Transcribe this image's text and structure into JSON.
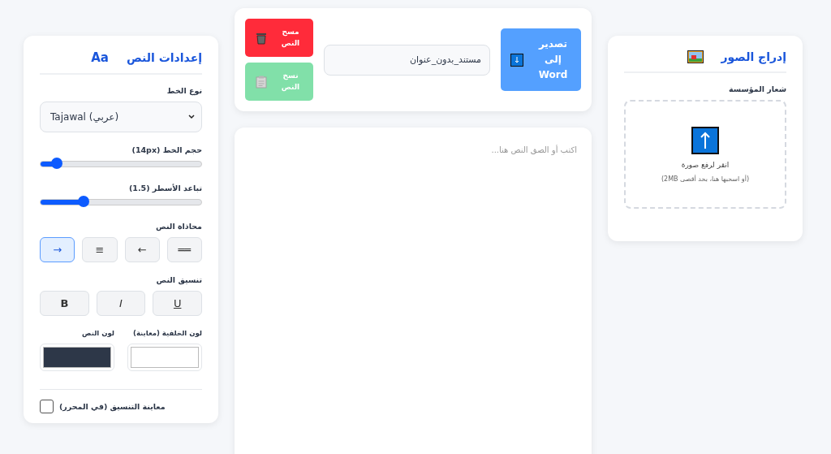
{
  "settings_panel": {
    "title": "إعدادات النص",
    "title_icon": "Aa",
    "font_family": {
      "label": "نوع الخط",
      "value": "Tajawal (عربي)"
    },
    "font_size": {
      "label": "حجم الخط (14px)",
      "level": 0.1
    },
    "line_height": {
      "label": "تباعد الأسطر (1.5)",
      "level": 0.27
    },
    "alignment": {
      "label": "محاذاة النص",
      "options": [
        {
          "symbol": "══",
          "selected": false
        },
        {
          "symbol": "←",
          "selected": false
        },
        {
          "symbol": "≡",
          "selected": false
        },
        {
          "symbol": "→",
          "selected": true
        }
      ]
    },
    "formatting": {
      "label": "تنسيق النص",
      "options": [
        {
          "symbol": "U",
          "kind": "underline"
        },
        {
          "symbol": "I",
          "kind": "italic"
        },
        {
          "symbol": "B",
          "kind": "bold"
        }
      ]
    },
    "colors": [
      {
        "label": "لون الخلفية (معاينة)",
        "color": "#ffffff"
      },
      {
        "label": "لون النص",
        "color": "#2d3748"
      }
    ],
    "preview_checkbox": {
      "label": "معاينة التنسيق (في المحرر)",
      "checked": false
    }
  },
  "toolbar": {
    "export_button": "تصدير إلى Word",
    "document_name": "مستند_بدون_عنوان",
    "clear_button": {
      "label": "مسح النص",
      "disabled": false
    },
    "copy_button": {
      "label": "نسخ النص",
      "disabled": true
    }
  },
  "editor": {
    "placeholder": "اكتب أو الصق النص هنا..."
  },
  "images_panel": {
    "title": "إدراج الصور",
    "logo_label": "شعار المؤسسة",
    "upload_text": "انقر لرفع صورة",
    "upload_hint": "(أو اسحبها هنا، بحد أقصى 2MB)"
  }
}
